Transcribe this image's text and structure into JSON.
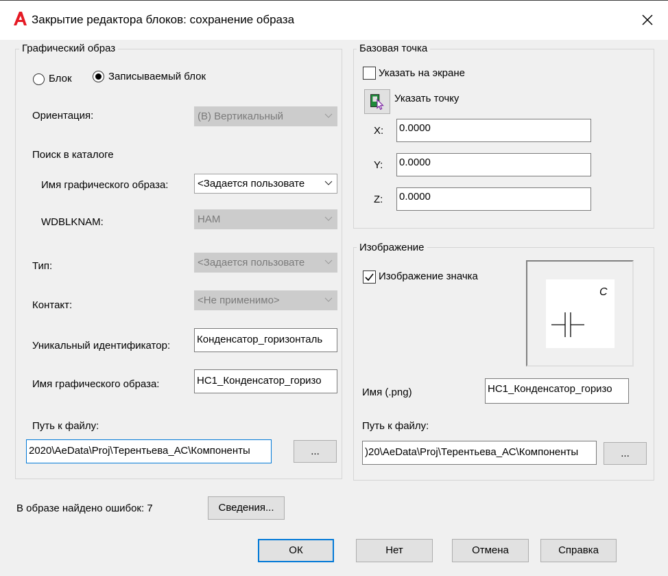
{
  "window": {
    "title": "Закрытие редактора блоков: сохранение образа"
  },
  "graphic": {
    "legend": "Графический образ",
    "radio_block": "Блок",
    "radio_writable": "Записываемый блок",
    "selected": "writable",
    "orientation_label": "Ориентация:",
    "orientation_value": "(В) Вертикальный",
    "catalog_label": "Поиск в каталоге",
    "graphic_name_label": "Имя графического образа:",
    "graphic_name_value": "<Задается пользовате",
    "wdblknam_label": "WDBLKNAM:",
    "wdblknam_value": "HAM",
    "type_label": "Тип:",
    "type_value": "<Задается пользовате",
    "contact_label": "Контакт:",
    "contact_value": "<Не применимо>",
    "uid_label": "Уникальный идентификатор:",
    "uid_value": "Конденсатор_горизонталь",
    "image_name_label": "Имя графического образа:",
    "image_name_value": "HC1_Конденсатор_горизо",
    "path_label": "Путь к файлу:",
    "path_value": "2020\\AeData\\Proj\\Терентьева_АС\\Компоненты",
    "browse_label": "..."
  },
  "base_point": {
    "legend": "Базовая точка",
    "on_screen_label": "Указать на экране",
    "on_screen_checked": false,
    "pick_label": "Указать точку",
    "x_label": "X:",
    "x_value": "0.0000",
    "y_label": "Y:",
    "y_value": "0.0000",
    "z_label": "Z:",
    "z_value": "0.0000"
  },
  "image": {
    "legend": "Изображение",
    "icon_label": "Изображение значка",
    "icon_checked": true,
    "preview_letter": "C",
    "name_label": "Имя (.png)",
    "name_value": "HC1_Конденсатор_горизо",
    "path_label": "Путь к файлу:",
    "path_value": ")20\\AeData\\Proj\\Терентьева_АС\\Компоненты",
    "browse_label": "..."
  },
  "footer": {
    "errors_text": "В образе найдено ошибок: 7",
    "details_label": "Сведения...",
    "ok_label": "ОК",
    "no_label": "Нет",
    "cancel_label": "Отмена",
    "help_label": "Справка"
  },
  "colors": {
    "accent": "#0078d7",
    "disabled": "#cccccc",
    "logo": "#e51a24"
  }
}
